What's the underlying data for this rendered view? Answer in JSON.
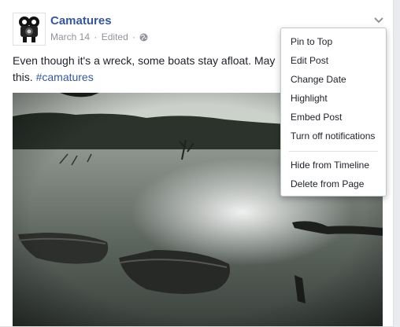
{
  "post": {
    "author": "Camatures",
    "date": "March 14",
    "separator": "·",
    "edited": "Edited",
    "audience_icon": "globe-icon",
    "text_before_tag": "Even though it's a wreck, some boats stay afloat. May",
    "text_after_first_line": "this.",
    "hashtag": "#camatures"
  },
  "menu": {
    "items": [
      {
        "label": "Pin to Top"
      },
      {
        "label": "Edit Post"
      },
      {
        "label": "Change Date"
      },
      {
        "label": "Highlight"
      },
      {
        "label": "Embed Post"
      },
      {
        "label": "Turn off notifications"
      }
    ],
    "items_after_divider": [
      {
        "label": "Hide from Timeline"
      },
      {
        "label": "Delete from Page"
      }
    ]
  },
  "colors": {
    "link": "#365899",
    "meta": "#90949c",
    "text": "#1d2129"
  }
}
